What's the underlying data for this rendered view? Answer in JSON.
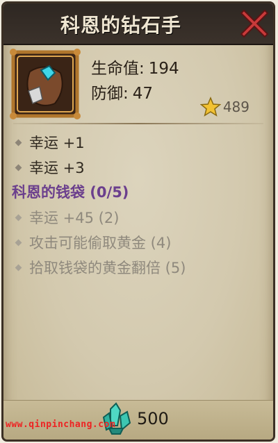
{
  "header": {
    "title": "科恩的钻石手"
  },
  "close": {
    "icon": "close-x-icon"
  },
  "item": {
    "icon": "diamond-glove-icon",
    "stats": [
      {
        "label": "生命值:",
        "value": "194"
      },
      {
        "label": "防御:",
        "value": "47"
      }
    ],
    "stars": {
      "icon": "star-icon",
      "value": "489"
    }
  },
  "attributes": [
    {
      "text": "幸运 +1"
    },
    {
      "text": "幸运 +3"
    }
  ],
  "set": {
    "title": "科恩的钱袋 (0/5)",
    "bonuses": [
      {
        "text": "幸运 +45 (2)"
      },
      {
        "text": "攻击可能偷取黄金 (4)"
      },
      {
        "text": "拾取钱袋的黄金翻倍 (5)"
      }
    ]
  },
  "price": {
    "icon": "gem-crystal-icon",
    "value": "500"
  },
  "watermark": "www.qinpinchang.com",
  "colors": {
    "set_title": "#6b3f8d",
    "title_bar": "#2e2722",
    "panel": "#d3c9ae"
  }
}
